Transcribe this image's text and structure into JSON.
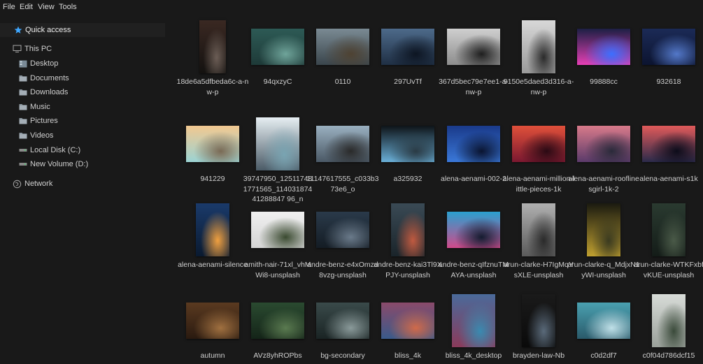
{
  "menu": {
    "file": "File",
    "edit": "Edit",
    "view": "View",
    "tools": "Tools"
  },
  "sidebar": {
    "quick_access": "Quick access",
    "this_pc": "This PC",
    "items": [
      {
        "label": "Desktop",
        "icon": "desktop-icon"
      },
      {
        "label": "Documents",
        "icon": "documents-folder-icon"
      },
      {
        "label": "Downloads",
        "icon": "downloads-folder-icon"
      },
      {
        "label": "Music",
        "icon": "music-folder-icon"
      },
      {
        "label": "Pictures",
        "icon": "pictures-folder-icon"
      },
      {
        "label": "Videos",
        "icon": "videos-folder-icon"
      },
      {
        "label": "Local Disk (C:)",
        "icon": "drive-icon"
      },
      {
        "label": "New Volume (D:)",
        "icon": "drive-icon"
      }
    ],
    "network": "Network"
  },
  "colors": {
    "background": "#191919",
    "text": "#d6d6d6",
    "accent": "#3fa7ff"
  },
  "files": [
    {
      "name": "18de6a5dfbeda6c-a-nw-p",
      "shape": "portrait-tall",
      "colors": [
        "#3a2822",
        "#141210",
        "#6b5d55"
      ]
    },
    {
      "name": "94qxzyC",
      "shape": "wide",
      "colors": [
        "#2d5a55",
        "#1e3a38",
        "#6fa49a"
      ]
    },
    {
      "name": "0110",
      "shape": "wide",
      "colors": [
        "#7a8a93",
        "#3a454c",
        "#4e4232"
      ]
    },
    {
      "name": "297UvTf",
      "shape": "wide",
      "colors": [
        "#4d6a8a",
        "#1f2f44",
        "#0d1522"
      ]
    },
    {
      "name": "367d5bec79e7ee1-a-nw-p",
      "shape": "wide",
      "colors": [
        "#cfcfcf",
        "#8d8d8d",
        "#1e1e1e"
      ]
    },
    {
      "name": "9150e5daed3d316-a-nw-p",
      "shape": "portrait",
      "colors": [
        "#d8d8d8",
        "#9a9a9a",
        "#2a2a2a"
      ]
    },
    {
      "name": "99888cc",
      "shape": "wide",
      "colors": [
        "#1c1f44",
        "#e63fb5",
        "#3c6fff"
      ]
    },
    {
      "name": "932618",
      "shape": "wide",
      "colors": [
        "#1b2a56",
        "#0c1430",
        "#5378c9"
      ]
    },
    {
      "name": "941229",
      "shape": "wide",
      "colors": [
        "#f2c890",
        "#9bd3d3",
        "#7a6a55"
      ]
    },
    {
      "name": "39747950_125117481771565_11403187441288847 96_n",
      "shape": "square",
      "colors": [
        "#e6eef2",
        "#4a5a66",
        "#79a4b2"
      ]
    },
    {
      "name": "11147617555_c033b373e6_o",
      "shape": "wide",
      "colors": [
        "#9ab0c0",
        "#4a5865",
        "#2a2a2a"
      ]
    },
    {
      "name": "a325932",
      "shape": "wide",
      "colors": [
        "#0e1418",
        "#6ab0d8",
        "#2a3a44"
      ]
    },
    {
      "name": "alena-aenami-002-2",
      "shape": "wide",
      "colors": [
        "#1a3a8a",
        "#3a78d8",
        "#0a1430"
      ]
    },
    {
      "name": "alena-aenami-million-little-pieces-1k",
      "shape": "wide",
      "colors": [
        "#e0503a",
        "#7a1830",
        "#2a0a14"
      ]
    },
    {
      "name": "alena-aenami-rooflinesgirl-1k-2",
      "shape": "wide",
      "colors": [
        "#d87a8a",
        "#5a3a6a",
        "#2a2a3a"
      ]
    },
    {
      "name": "alena-aenami-s1k",
      "shape": "wide",
      "colors": [
        "#e05a5a",
        "#2a2a4a",
        "#0c0c1a"
      ]
    },
    {
      "name": "alena-aenami-silence",
      "shape": "portrait",
      "colors": [
        "#1a3a6a",
        "#0a1a30",
        "#f0a040"
      ]
    },
    {
      "name": "amith-nair-71xl_vhMWi8-unsplash",
      "shape": "wide",
      "colors": [
        "#f0f0f0",
        "#d4d4d4",
        "#3a4a30"
      ]
    },
    {
      "name": "andre-benz-e4xOmzd8vzg-unsplash",
      "shape": "wide",
      "colors": [
        "#2a3a4a",
        "#141c24",
        "#6a7a8a"
      ]
    },
    {
      "name": "andre-benz-kai3Tl9XPJY-unsplash",
      "shape": "portrait",
      "colors": [
        "#3a4a55",
        "#1a242a",
        "#c05a40"
      ]
    },
    {
      "name": "andre-benz-qIfznuTMAYA-unsplash",
      "shape": "wide",
      "colors": [
        "#2aa0d0",
        "#d04a8a",
        "#141c30"
      ]
    },
    {
      "name": "arun-clarke-H7IgMqYsXLE-unsplash",
      "shape": "portrait",
      "colors": [
        "#b0b0b0",
        "#5a5a5a",
        "#2a2a2a"
      ]
    },
    {
      "name": "arun-clarke-q_MdjxN1yWI-unsplash",
      "shape": "portrait",
      "colors": [
        "#1a1a10",
        "#c0a030",
        "#3a3a20"
      ]
    },
    {
      "name": "arun-clarke-WTKFxbfvKUE-unsplash",
      "shape": "portrait",
      "colors": [
        "#2a3a30",
        "#141c18",
        "#4a5a48"
      ]
    },
    {
      "name": "autumn",
      "shape": "wide",
      "colors": [
        "#5a3a20",
        "#2a1a10",
        "#a07040"
      ]
    },
    {
      "name": "AVz8yhROPbs",
      "shape": "wide",
      "colors": [
        "#2a4a30",
        "#142418",
        "#5a7a50"
      ]
    },
    {
      "name": "bg-secondary",
      "shape": "wide",
      "colors": [
        "#3a4a4a",
        "#1a2424",
        "#8a9a9a"
      ]
    },
    {
      "name": "bliss_4k",
      "shape": "wide",
      "colors": [
        "#8a4a6a",
        "#3a5a8a",
        "#d06a4a"
      ]
    },
    {
      "name": "bliss_4k_desktop",
      "shape": "square",
      "colors": [
        "#4a6a9a",
        "#8a3a5a",
        "#3a8ab0"
      ]
    },
    {
      "name": "brayden-law-Nb",
      "shape": "portrait",
      "colors": [
        "#1a1a1a",
        "#0a0a0a",
        "#5a6a7a"
      ]
    },
    {
      "name": "c0d2df7",
      "shape": "wide",
      "colors": [
        "#4aa0b0",
        "#2a5a6a",
        "#c0e0e8"
      ]
    },
    {
      "name": "c0f04d786dcf15",
      "shape": "portrait",
      "colors": [
        "#d8dcd8",
        "#9aa09a",
        "#3a4a3a"
      ]
    }
  ]
}
